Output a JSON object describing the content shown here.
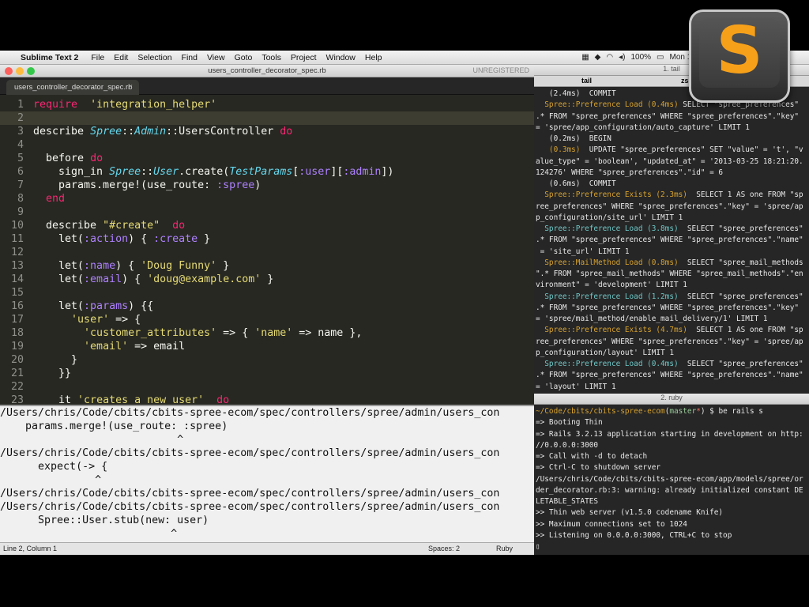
{
  "menubar": {
    "app_name": "Sublime Text 2",
    "items": [
      "File",
      "Edit",
      "Selection",
      "Find",
      "View",
      "Goto",
      "Tools",
      "Project",
      "Window",
      "Help"
    ],
    "battery": "100%",
    "clock": "Mon 11:49"
  },
  "editor_window": {
    "title": "users_controller_decorator_spec.rb",
    "registration": "UNREGISTERED",
    "tab_label": "users_controller_decorator_spec.rb",
    "tab_close": "×",
    "lines": [
      {
        "n": "1",
        "tokens": [
          [
            "kw",
            "require"
          ],
          [
            "",
            "  "
          ],
          [
            "st",
            "'integration_helper'"
          ]
        ]
      },
      {
        "n": "2",
        "tokens": []
      },
      {
        "n": "3",
        "tokens": [
          [
            "",
            "describe "
          ],
          [
            "cn",
            "Spree"
          ],
          [
            "",
            "::"
          ],
          [
            "cn",
            "Admin"
          ],
          [
            "",
            "::UsersController "
          ],
          [
            "kw",
            "do"
          ]
        ]
      },
      {
        "n": "4",
        "tokens": []
      },
      {
        "n": "5",
        "tokens": [
          [
            "",
            "  before "
          ],
          [
            "kw",
            "do"
          ]
        ]
      },
      {
        "n": "6",
        "tokens": [
          [
            "",
            "    sign_in "
          ],
          [
            "cn",
            "Spree"
          ],
          [
            "",
            "::"
          ],
          [
            "cn",
            "User"
          ],
          [
            "",
            ".create("
          ],
          [
            "cn",
            "TestParams"
          ],
          [
            "",
            "["
          ],
          [
            "sy",
            ":user"
          ],
          [
            "",
            "]["
          ],
          [
            "sy",
            ":admin"
          ],
          [
            "",
            "])"
          ]
        ]
      },
      {
        "n": "7",
        "tokens": [
          [
            "",
            "    params.merge!(use_route: "
          ],
          [
            "sy",
            ":spree"
          ],
          [
            "",
            ")"
          ]
        ]
      },
      {
        "n": "8",
        "tokens": [
          [
            "",
            "  "
          ],
          [
            "kw",
            "end"
          ]
        ]
      },
      {
        "n": "9",
        "tokens": []
      },
      {
        "n": "10",
        "tokens": [
          [
            "",
            "  describe "
          ],
          [
            "st",
            "\"#create\""
          ],
          [
            "",
            "  "
          ],
          [
            "kw",
            "do"
          ]
        ]
      },
      {
        "n": "11",
        "tokens": [
          [
            "",
            "    let("
          ],
          [
            "sy",
            ":action"
          ],
          [
            "",
            ") { "
          ],
          [
            "sy",
            ":create"
          ],
          [
            "",
            " }"
          ]
        ]
      },
      {
        "n": "12",
        "tokens": []
      },
      {
        "n": "13",
        "tokens": [
          [
            "",
            "    let("
          ],
          [
            "sy",
            ":name"
          ],
          [
            "",
            ") { "
          ],
          [
            "st",
            "'Doug Funny'"
          ],
          [
            "",
            " }"
          ]
        ]
      },
      {
        "n": "14",
        "tokens": [
          [
            "",
            "    let("
          ],
          [
            "sy",
            ":email"
          ],
          [
            "",
            ") { "
          ],
          [
            "st",
            "'doug@example.com'"
          ],
          [
            "",
            " }"
          ]
        ]
      },
      {
        "n": "15",
        "tokens": []
      },
      {
        "n": "16",
        "tokens": [
          [
            "",
            "    let("
          ],
          [
            "sy",
            ":params"
          ],
          [
            "",
            ") {{"
          ]
        ]
      },
      {
        "n": "17",
        "tokens": [
          [
            "",
            "      "
          ],
          [
            "st",
            "'user'"
          ],
          [
            "",
            " => {"
          ]
        ]
      },
      {
        "n": "18",
        "tokens": [
          [
            "",
            "        "
          ],
          [
            "st",
            "'customer_attributes'"
          ],
          [
            "",
            " => { "
          ],
          [
            "st",
            "'name'"
          ],
          [
            "",
            " => name },"
          ]
        ]
      },
      {
        "n": "19",
        "tokens": [
          [
            "",
            "        "
          ],
          [
            "st",
            "'email'"
          ],
          [
            "",
            " => email"
          ]
        ]
      },
      {
        "n": "20",
        "tokens": [
          [
            "",
            "      }"
          ]
        ]
      },
      {
        "n": "21",
        "tokens": [
          [
            "",
            "    }}"
          ]
        ]
      },
      {
        "n": "22",
        "tokens": []
      },
      {
        "n": "23",
        "tokens": [
          [
            "",
            "    it "
          ],
          [
            "st",
            "'creates a new user'"
          ],
          [
            "",
            "  "
          ],
          [
            "kw",
            "do"
          ]
        ]
      }
    ],
    "console_lines": [
      "/Users/chris/Code/cbits/cbits-spree-ecom/spec/controllers/spree/admin/users_con",
      "    params.merge!(use_route: :spree)",
      "                            ^",
      "/Users/chris/Code/cbits/cbits-spree-ecom/spec/controllers/spree/admin/users_con",
      "      expect(-> {",
      "               ^",
      "/Users/chris/Code/cbits/cbits-spree-ecom/spec/controllers/spree/admin/users_con",
      "/Users/chris/Code/cbits/cbits-spree-ecom/spec/controllers/spree/admin/users_con",
      "      Spree::User.stub(new: user)",
      "                           ^"
    ],
    "status_position": "Line 2, Column 1",
    "status_spaces": "Spaces: 2",
    "status_syntax": "Ruby"
  },
  "terminal_tail": {
    "title": "1. tail",
    "tab_active": "tail",
    "tab_other": "zs",
    "lines": [
      [
        [
          "",
          "   (2.4ms)  COMMIT"
        ]
      ],
      [
        [
          "y",
          "  Spree::Preference Load (0.4ms)"
        ],
        [
          "",
          " "
        ],
        [
          "",
          "SELECT \"spree_preferences\""
        ]
      ],
      [
        [
          "",
          ".* FROM \"spree_preferences\" WHERE \"spree_preferences\".\"key\""
        ]
      ],
      [
        [
          "",
          "= 'spree/app_configuration/auto_capture' LIMIT 1"
        ]
      ],
      [
        [
          "",
          "   (0.2ms)  BEGIN"
        ]
      ],
      [
        [
          "y",
          "   (0.3ms)"
        ],
        [
          "",
          "  UPDATE \"spree_preferences\" SET \"value\" = 't', \"v"
        ]
      ],
      [
        [
          "",
          "alue_type\" = 'boolean', \"updated_at\" = '2013-03-25 18:21:20."
        ]
      ],
      [
        [
          "",
          "124276' WHERE \"spree_preferences\".\"id\" = 6"
        ]
      ],
      [
        [
          "",
          "   (0.6ms)  COMMIT"
        ]
      ],
      [
        [
          "y",
          "  Spree::Preference Exists (2.3ms)"
        ],
        [
          "",
          "  SELECT 1 AS one FROM \"sp"
        ]
      ],
      [
        [
          "",
          "ree_preferences\" WHERE \"spree_preferences\".\"key\" = 'spree/ap"
        ]
      ],
      [
        [
          "",
          "p_configuration/site_url' LIMIT 1"
        ]
      ],
      [
        [
          "cy",
          "  Spree::Preference Load (3.8ms)"
        ],
        [
          "",
          "  SELECT \"spree_preferences\""
        ]
      ],
      [
        [
          "",
          ".* FROM \"spree_preferences\" WHERE \"spree_preferences\".\"name\""
        ]
      ],
      [
        [
          "",
          ""
        ],
        [
          "",
          " = 'site_url' LIMIT 1"
        ]
      ],
      [
        [
          "y",
          "  Spree::MailMethod Load (0.8ms)"
        ],
        [
          "",
          "  SELECT \"spree_mail_methods"
        ]
      ],
      [
        [
          "",
          "\".* FROM \"spree_mail_methods\" WHERE \"spree_mail_methods\".\"en"
        ]
      ],
      [
        [
          "",
          "vironment\" = 'development' LIMIT 1"
        ]
      ],
      [
        [
          "cy",
          "  Spree::Preference Load (1.2ms)"
        ],
        [
          "",
          "  SELECT \"spree_preferences\""
        ]
      ],
      [
        [
          "",
          ".* FROM \"spree_preferences\" WHERE \"spree_preferences\".\"key\""
        ]
      ],
      [
        [
          "",
          "= 'spree/mail_method/enable_mail_delivery/1' LIMIT 1"
        ]
      ],
      [
        [
          "y",
          "  Spree::Preference Exists (4.7ms)"
        ],
        [
          "",
          "  SELECT 1 AS one FROM \"sp"
        ]
      ],
      [
        [
          "",
          "ree_preferences\" WHERE \"spree_preferences\".\"key\" = 'spree/ap"
        ]
      ],
      [
        [
          "",
          "p_configuration/layout' LIMIT 1"
        ]
      ],
      [
        [
          "cy",
          "  Spree::Preference Load (0.4ms)"
        ],
        [
          "",
          "  SELECT \"spree_preferences\""
        ]
      ],
      [
        [
          "",
          ".* FROM \"spree_preferences\" WHERE \"spree_preferences\".\"name\""
        ]
      ],
      [
        [
          "",
          "= 'layout' LIMIT 1"
        ]
      ]
    ]
  },
  "terminal_ruby": {
    "title": "2. ruby",
    "lines": [
      [
        [
          "y",
          "~/Code/cbits/cbits-spree-ecom"
        ],
        [
          "",
          "("
        ],
        [
          "gr",
          "master"
        ],
        [
          "rd",
          "*"
        ],
        [
          "",
          ") $ be rails s"
        ]
      ],
      [
        [
          "",
          "=> Booting Thin"
        ]
      ],
      [
        [
          "",
          "=> Rails 3.2.13 application starting in development on http:"
        ]
      ],
      [
        [
          "",
          "//0.0.0.0:3000"
        ]
      ],
      [
        [
          "",
          "=> Call with -d to detach"
        ]
      ],
      [
        [
          "",
          "=> Ctrl-C to shutdown server"
        ]
      ],
      [
        [
          "",
          "/Users/chris/Code/cbits/cbits-spree-ecom/app/models/spree/or"
        ]
      ],
      [
        [
          "",
          "der_decorator.rb:3: warning: already initialized constant DE"
        ]
      ],
      [
        [
          "",
          "LETABLE_STATES"
        ]
      ],
      [
        [
          "",
          ">> Thin web server (v1.5.0 codename Knife)"
        ]
      ],
      [
        [
          "",
          ">> Maximum connections set to 1024"
        ]
      ],
      [
        [
          "",
          ">> Listening on 0.0.0.0:3000, CTRL+C to stop"
        ]
      ],
      [
        [
          "",
          "▯"
        ]
      ]
    ]
  },
  "logo": {
    "letter": "S"
  },
  "colors": {
    "editor_bg": "#272822",
    "keyword": "#f92672",
    "string": "#e6db74",
    "constant": "#66d9ef",
    "symbol": "#ae81ff",
    "terminal_bg": "#262626"
  }
}
